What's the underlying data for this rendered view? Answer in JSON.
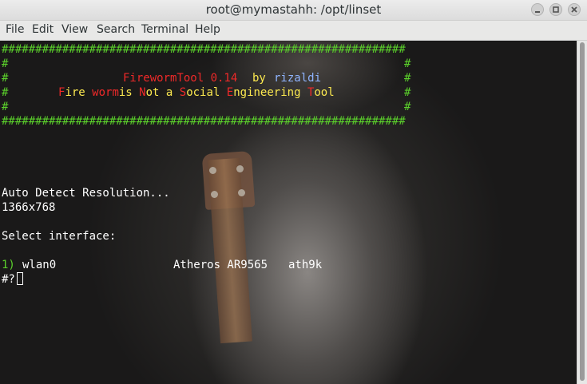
{
  "window": {
    "title": "root@mymastahh: /opt/linset"
  },
  "menu": [
    "File",
    "Edit",
    "View",
    "Search",
    "Terminal",
    "Help"
  ],
  "terminal": {
    "border": "############################################################",
    "hash": "#",
    "title_tool": "FirewormTool 0.14",
    "title_by": "by",
    "title_author": "rizaldi",
    "sub": [
      "F",
      "ire ",
      "worm",
      "is ",
      "N",
      "ot a ",
      "S",
      "ocial ",
      "E",
      "ngineering ",
      "T",
      "ool"
    ],
    "auto_detect": "Auto Detect Resolution...",
    "resolution": "1366x768",
    "select_prompt": "Select interface:",
    "option_number": "1)",
    "option_iface": "wlan0",
    "option_chipset": "Atheros AR9565",
    "option_driver": "ath9k",
    "input_prompt": "#?"
  },
  "colors": {
    "banner_green": "#5bd02b",
    "red": "#ef2929",
    "yellow": "#fce94f",
    "blue": "#8fb4ff"
  }
}
